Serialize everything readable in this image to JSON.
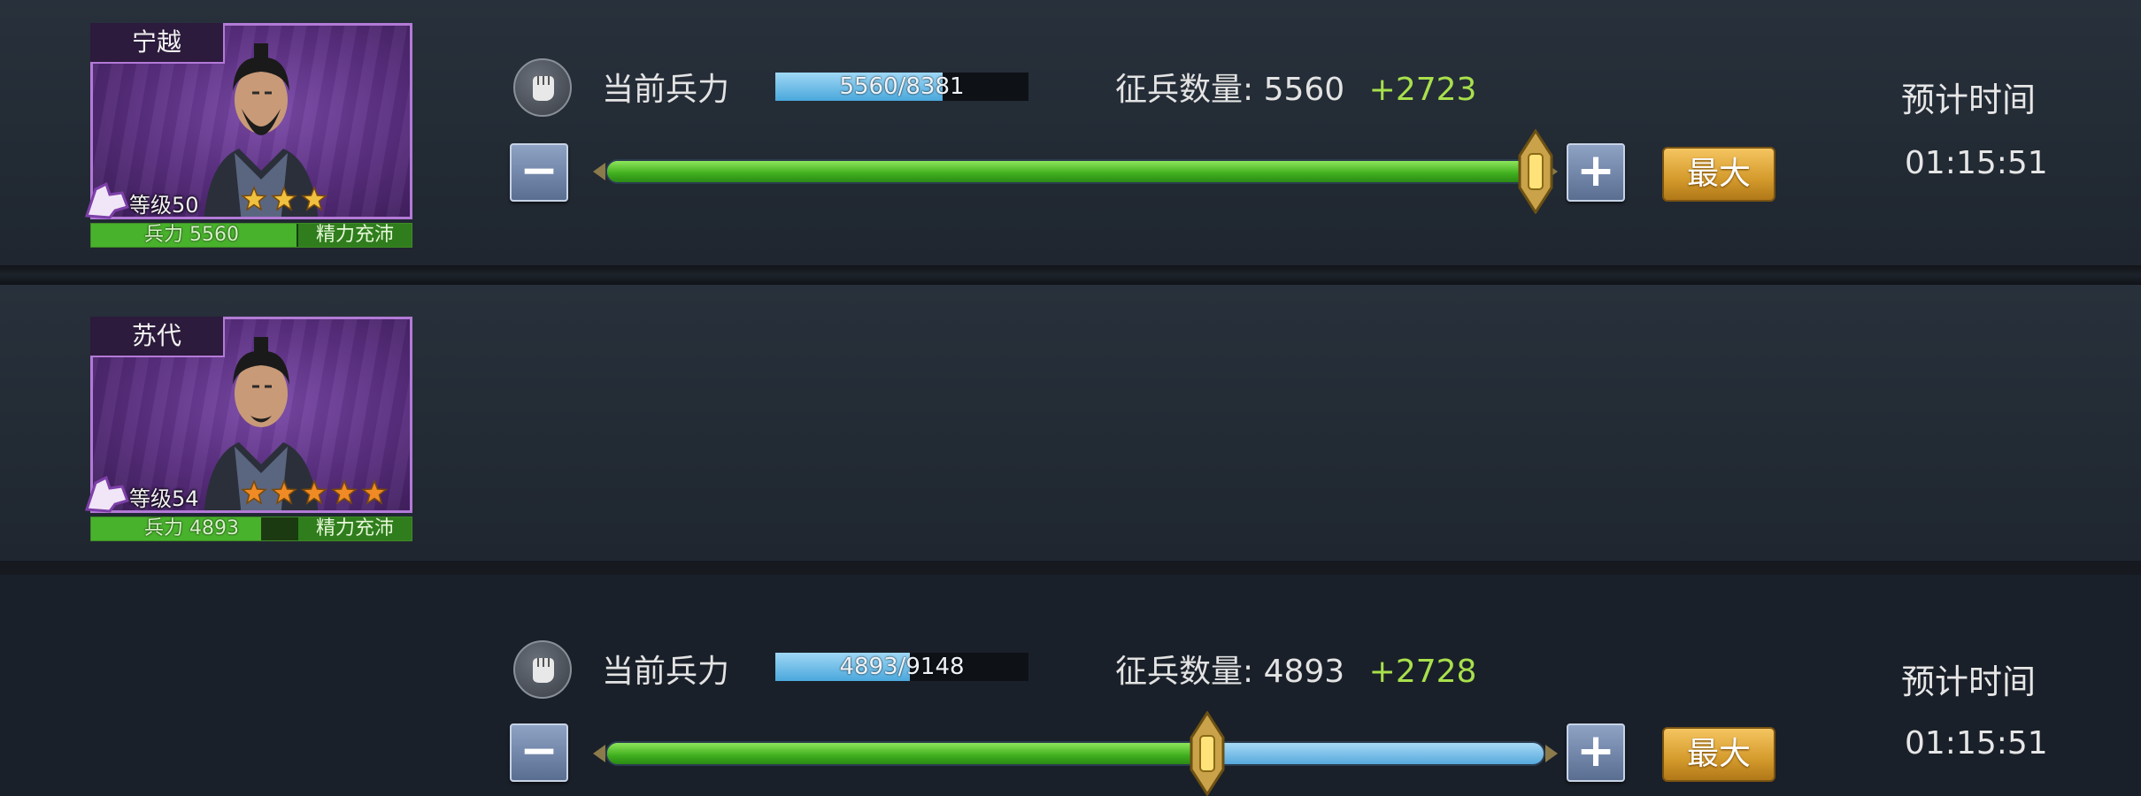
{
  "generals": [
    {
      "name": "宁越",
      "level_text": "等级50",
      "stars": 3,
      "star_color": "#f0c040",
      "troop_text": "兵力 5560",
      "troop_fraction": 0.66,
      "spirit_text": "精力充沛",
      "current_label": "当前兵力",
      "current_troops": "5560/8381",
      "current_fraction": 0.66,
      "recruit_label": "征兵数量:",
      "recruit_count": "5560",
      "recruit_plus": "+2723",
      "slider_fraction": 0.99,
      "max_label": "最大",
      "eta_label": "预计时间",
      "eta_time": "01:15:51",
      "icons": {
        "fist": "fist-icon",
        "rank": "horse-rank-icon",
        "minus": "minus-icon",
        "plus": "plus-icon"
      }
    },
    {
      "name": "苏代",
      "level_text": "等级54",
      "stars": 5,
      "star_color": "#f08a24",
      "troop_text": "兵力 4893",
      "troop_fraction": 0.53,
      "spirit_text": "精力充沛",
      "current_label": "当前兵力",
      "current_troops": "4893/9148",
      "current_fraction": 0.53,
      "recruit_label": "征兵数量:",
      "recruit_count": "4893",
      "recruit_plus": "+2728",
      "slider_fraction": 0.64,
      "max_label": "最大",
      "eta_label": "预计时间",
      "eta_time": "01:15:51",
      "icons": {
        "fist": "fist-icon",
        "rank": "horse-rank-icon",
        "minus": "minus-icon",
        "plus": "plus-icon"
      }
    }
  ],
  "colors": {
    "slider_green": "#3fae1e",
    "slider_blue": "#56a9dc",
    "recruit_plus": "#a8e04c",
    "max_button": "#d49a2c",
    "card_border": "#b37ad6"
  }
}
